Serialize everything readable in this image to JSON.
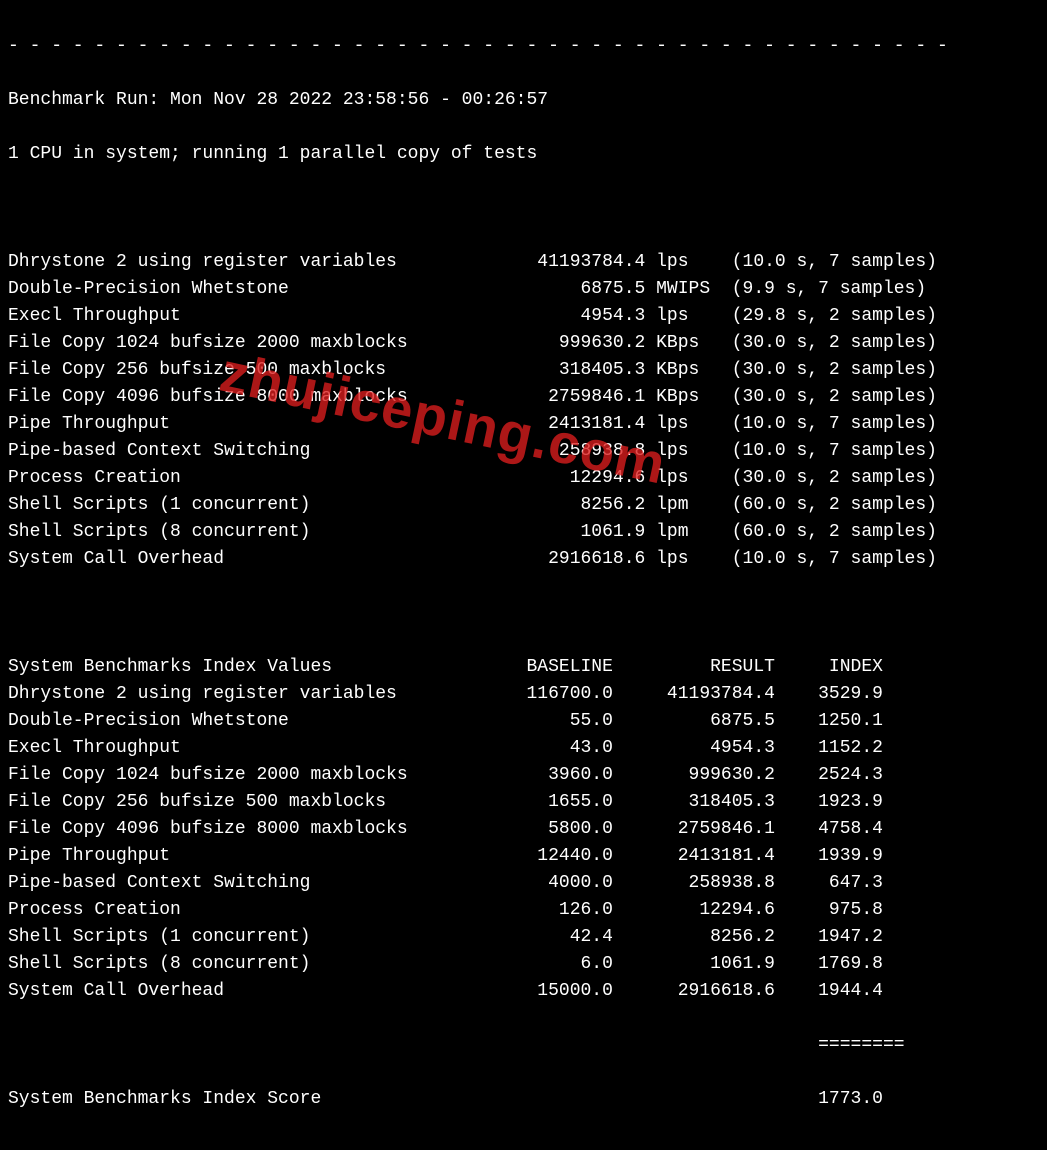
{
  "separator": "- - - - - - - - - - - - - - - - - - - - - - - - - - - - - - - - - - - - - - - - - - - -",
  "header": {
    "run_line": "Benchmark Run: Mon Nov 28 2022 23:58:56 - 00:26:57",
    "cpu_line": "1 CPU in system; running 1 parallel copy of tests"
  },
  "results": [
    {
      "name": "Dhrystone 2 using register variables",
      "value": "41193784.4",
      "unit": "lps",
      "timing": "(10.0 s, 7 samples)"
    },
    {
      "name": "Double-Precision Whetstone",
      "value": "6875.5",
      "unit": "MWIPS",
      "timing": "(9.9 s, 7 samples)"
    },
    {
      "name": "Execl Throughput",
      "value": "4954.3",
      "unit": "lps",
      "timing": "(29.8 s, 2 samples)"
    },
    {
      "name": "File Copy 1024 bufsize 2000 maxblocks",
      "value": "999630.2",
      "unit": "KBps",
      "timing": "(30.0 s, 2 samples)"
    },
    {
      "name": "File Copy 256 bufsize 500 maxblocks",
      "value": "318405.3",
      "unit": "KBps",
      "timing": "(30.0 s, 2 samples)"
    },
    {
      "name": "File Copy 4096 bufsize 8000 maxblocks",
      "value": "2759846.1",
      "unit": "KBps",
      "timing": "(30.0 s, 2 samples)"
    },
    {
      "name": "Pipe Throughput",
      "value": "2413181.4",
      "unit": "lps",
      "timing": "(10.0 s, 7 samples)"
    },
    {
      "name": "Pipe-based Context Switching",
      "value": "258938.8",
      "unit": "lps",
      "timing": "(10.0 s, 7 samples)"
    },
    {
      "name": "Process Creation",
      "value": "12294.6",
      "unit": "lps",
      "timing": "(30.0 s, 2 samples)"
    },
    {
      "name": "Shell Scripts (1 concurrent)",
      "value": "8256.2",
      "unit": "lpm",
      "timing": "(60.0 s, 2 samples)"
    },
    {
      "name": "Shell Scripts (8 concurrent)",
      "value": "1061.9",
      "unit": "lpm",
      "timing": "(60.0 s, 2 samples)"
    },
    {
      "name": "System Call Overhead",
      "value": "2916618.6",
      "unit": "lps",
      "timing": "(10.0 s, 7 samples)"
    }
  ],
  "index_header": {
    "title": "System Benchmarks Index Values",
    "baseline": "BASELINE",
    "result": "RESULT",
    "index": "INDEX"
  },
  "index_rows": [
    {
      "name": "Dhrystone 2 using register variables",
      "baseline": "116700.0",
      "result": "41193784.4",
      "index": "3529.9"
    },
    {
      "name": "Double-Precision Whetstone",
      "baseline": "55.0",
      "result": "6875.5",
      "index": "1250.1"
    },
    {
      "name": "Execl Throughput",
      "baseline": "43.0",
      "result": "4954.3",
      "index": "1152.2"
    },
    {
      "name": "File Copy 1024 bufsize 2000 maxblocks",
      "baseline": "3960.0",
      "result": "999630.2",
      "index": "2524.3"
    },
    {
      "name": "File Copy 256 bufsize 500 maxblocks",
      "baseline": "1655.0",
      "result": "318405.3",
      "index": "1923.9"
    },
    {
      "name": "File Copy 4096 bufsize 8000 maxblocks",
      "baseline": "5800.0",
      "result": "2759846.1",
      "index": "4758.4"
    },
    {
      "name": "Pipe Throughput",
      "baseline": "12440.0",
      "result": "2413181.4",
      "index": "1939.9"
    },
    {
      "name": "Pipe-based Context Switching",
      "baseline": "4000.0",
      "result": "258938.8",
      "index": "647.3"
    },
    {
      "name": "Process Creation",
      "baseline": "126.0",
      "result": "12294.6",
      "index": "975.8"
    },
    {
      "name": "Shell Scripts (1 concurrent)",
      "baseline": "42.4",
      "result": "8256.2",
      "index": "1947.2"
    },
    {
      "name": "Shell Scripts (8 concurrent)",
      "baseline": "6.0",
      "result": "1061.9",
      "index": "1769.8"
    },
    {
      "name": "System Call Overhead",
      "baseline": "15000.0",
      "result": "2916618.6",
      "index": "1944.4"
    }
  ],
  "score_rule": "                                                                           ========",
  "score_label": "System Benchmarks Index Score",
  "score_value": "1773.0",
  "watermark": "zhujiceping.com"
}
